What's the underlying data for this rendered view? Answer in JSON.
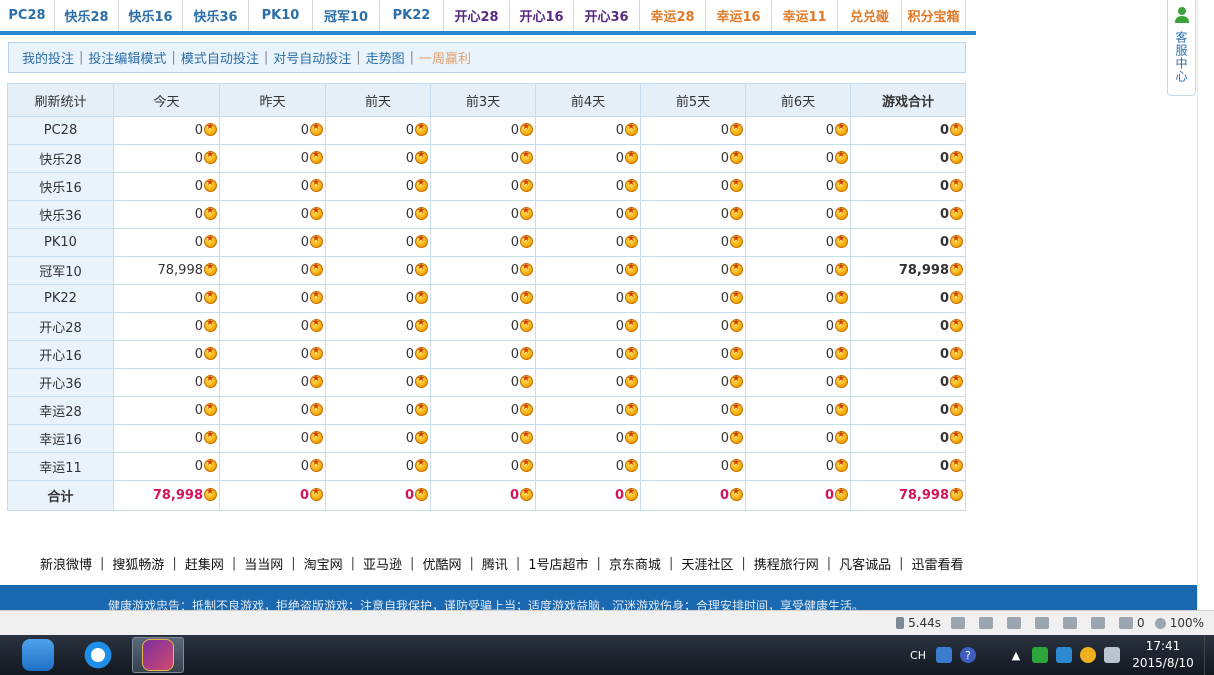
{
  "tabs": [
    {
      "label": "PC28",
      "color": "blue",
      "w": 55
    },
    {
      "label": "快乐28",
      "color": "blue",
      "w": 64
    },
    {
      "label": "快乐16",
      "color": "blue",
      "w": 64
    },
    {
      "label": "快乐36",
      "color": "blue",
      "w": 66
    },
    {
      "label": "PK10",
      "color": "blue",
      "w": 64
    },
    {
      "label": "冠军10",
      "color": "blue",
      "w": 67
    },
    {
      "label": "PK22",
      "color": "blue",
      "w": 64
    },
    {
      "label": "开心28",
      "color": "purple",
      "w": 66
    },
    {
      "label": "开心16",
      "color": "purple",
      "w": 64
    },
    {
      "label": "开心36",
      "color": "purple",
      "w": 66
    },
    {
      "label": "幸运28",
      "color": "orange",
      "w": 66
    },
    {
      "label": "幸运16",
      "color": "orange",
      "w": 66
    },
    {
      "label": "幸运11",
      "color": "orange",
      "w": 66
    },
    {
      "label": "兑兑碰",
      "color": "orange",
      "w": 64
    },
    {
      "label": "积分宝箱",
      "color": "orange",
      "w": 64
    }
  ],
  "subnav": {
    "items": [
      "我的投注",
      "投注编辑模式",
      "模式自动投注",
      "对号自动投注",
      "走势图",
      "一周赢利"
    ],
    "active_index": 5
  },
  "table": {
    "headers": [
      "刷新统计",
      "今天",
      "昨天",
      "前天",
      "前3天",
      "前4天",
      "前5天",
      "前6天",
      "游戏合计"
    ],
    "rows": [
      {
        "name": "PC28",
        "values": [
          "0",
          "0",
          "0",
          "0",
          "0",
          "0",
          "0",
          "0"
        ]
      },
      {
        "name": "快乐28",
        "values": [
          "0",
          "0",
          "0",
          "0",
          "0",
          "0",
          "0",
          "0"
        ]
      },
      {
        "name": "快乐16",
        "values": [
          "0",
          "0",
          "0",
          "0",
          "0",
          "0",
          "0",
          "0"
        ]
      },
      {
        "name": "快乐36",
        "values": [
          "0",
          "0",
          "0",
          "0",
          "0",
          "0",
          "0",
          "0"
        ]
      },
      {
        "name": "PK10",
        "values": [
          "0",
          "0",
          "0",
          "0",
          "0",
          "0",
          "0",
          "0"
        ]
      },
      {
        "name": "冠军10",
        "values": [
          "78,998",
          "0",
          "0",
          "0",
          "0",
          "0",
          "0",
          "78,998"
        ]
      },
      {
        "name": "PK22",
        "values": [
          "0",
          "0",
          "0",
          "0",
          "0",
          "0",
          "0",
          "0"
        ]
      },
      {
        "name": "开心28",
        "values": [
          "0",
          "0",
          "0",
          "0",
          "0",
          "0",
          "0",
          "0"
        ]
      },
      {
        "name": "开心16",
        "values": [
          "0",
          "0",
          "0",
          "0",
          "0",
          "0",
          "0",
          "0"
        ]
      },
      {
        "name": "开心36",
        "values": [
          "0",
          "0",
          "0",
          "0",
          "0",
          "0",
          "0",
          "0"
        ]
      },
      {
        "name": "幸运28",
        "values": [
          "0",
          "0",
          "0",
          "0",
          "0",
          "0",
          "0",
          "0"
        ]
      },
      {
        "name": "幸运16",
        "values": [
          "0",
          "0",
          "0",
          "0",
          "0",
          "0",
          "0",
          "0"
        ]
      },
      {
        "name": "幸运11",
        "values": [
          "0",
          "0",
          "0",
          "0",
          "0",
          "0",
          "0",
          "0"
        ]
      }
    ],
    "total": {
      "name": "合计",
      "values": [
        "78,998",
        "0",
        "0",
        "0",
        "0",
        "0",
        "0",
        "78,998"
      ]
    }
  },
  "customer_service": {
    "label": "客服中心"
  },
  "footer_links": [
    "新浪微博",
    "搜狐畅游",
    "赶集网",
    "当当网",
    "淘宝网",
    "亚马逊",
    "优酷网",
    "腾讯",
    "1号店超市",
    "京东商城",
    "天涯社区",
    "携程旅行网",
    "凡客诚品",
    "迅雷看看"
  ],
  "footer_notice": "健康游戏忠告：抵制不良游戏，拒绝盗版游戏；注意自我保护，谨防受骗上当；适度游戏益脑，沉迷游戏伤身；合理安排时间，享受健康生活。",
  "statusbar": {
    "load_time": "5.44s",
    "blocked": "0",
    "zoom": "100%"
  },
  "taskbar": {
    "apps": [
      "baidu-cloud-icon",
      "qq-browser-icon",
      "lucky-game-icon"
    ]
  },
  "tray": {
    "lang": "CH",
    "time": "17:41",
    "date": "2015/8/10"
  },
  "colors": {
    "accent": "#2b86d0",
    "total_red": "#d4145a",
    "header_bg": "#e4eff8"
  }
}
